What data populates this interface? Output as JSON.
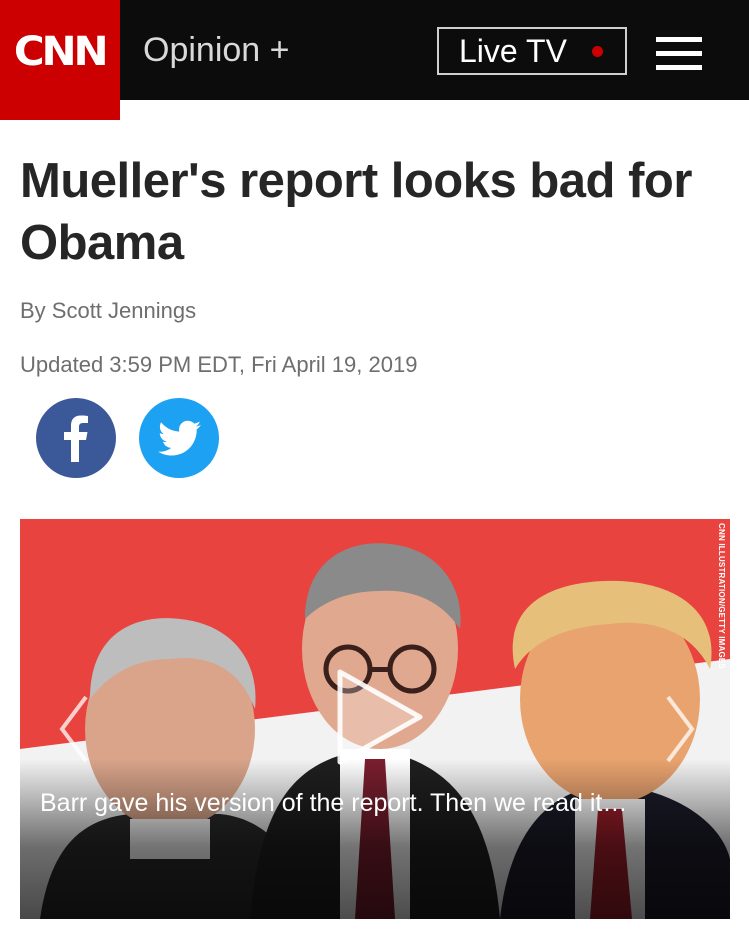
{
  "header": {
    "logo_text": "CNN",
    "section_label": "Opinion +",
    "live_tv_label": "Live TV",
    "accent_color": "#cc0000"
  },
  "article": {
    "headline": "Mueller's report looks bad for Obama",
    "byline": "By Scott Jennings",
    "updated": "Updated 3:59 PM EDT, Fri April 19, 2019"
  },
  "share": {
    "facebook_icon": "facebook-icon",
    "twitter_icon": "twitter-icon"
  },
  "media": {
    "credit": "CNN ILLUSTRATION/GETTY IMAGES",
    "caption": "Barr gave his version of the report. Then we read it…"
  }
}
